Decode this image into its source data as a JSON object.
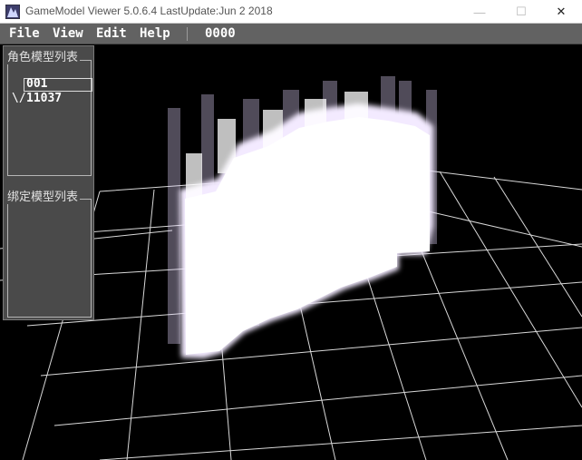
{
  "window": {
    "title": "GameModel Viewer 5.0.6.4 LastUpdate:Jun  2 2018",
    "icon": "app-icon",
    "controls": {
      "minimize": "—",
      "maximize": "☐",
      "close": "✕"
    }
  },
  "menu": {
    "items": [
      "File",
      "View",
      "Edit",
      "Help"
    ],
    "counter": "0000"
  },
  "panel": {
    "character_list": {
      "title": "角色模型列表",
      "items": [
        "001",
        "11037"
      ],
      "expand_marker": "\\/"
    },
    "bind_list": {
      "title": "绑定模型列表"
    }
  },
  "colors": {
    "background": "#000000",
    "panel": "#4a4a4a",
    "menubar": "#626262",
    "grid": "#d8d8d8",
    "model_glow": "#e6d8ff"
  }
}
